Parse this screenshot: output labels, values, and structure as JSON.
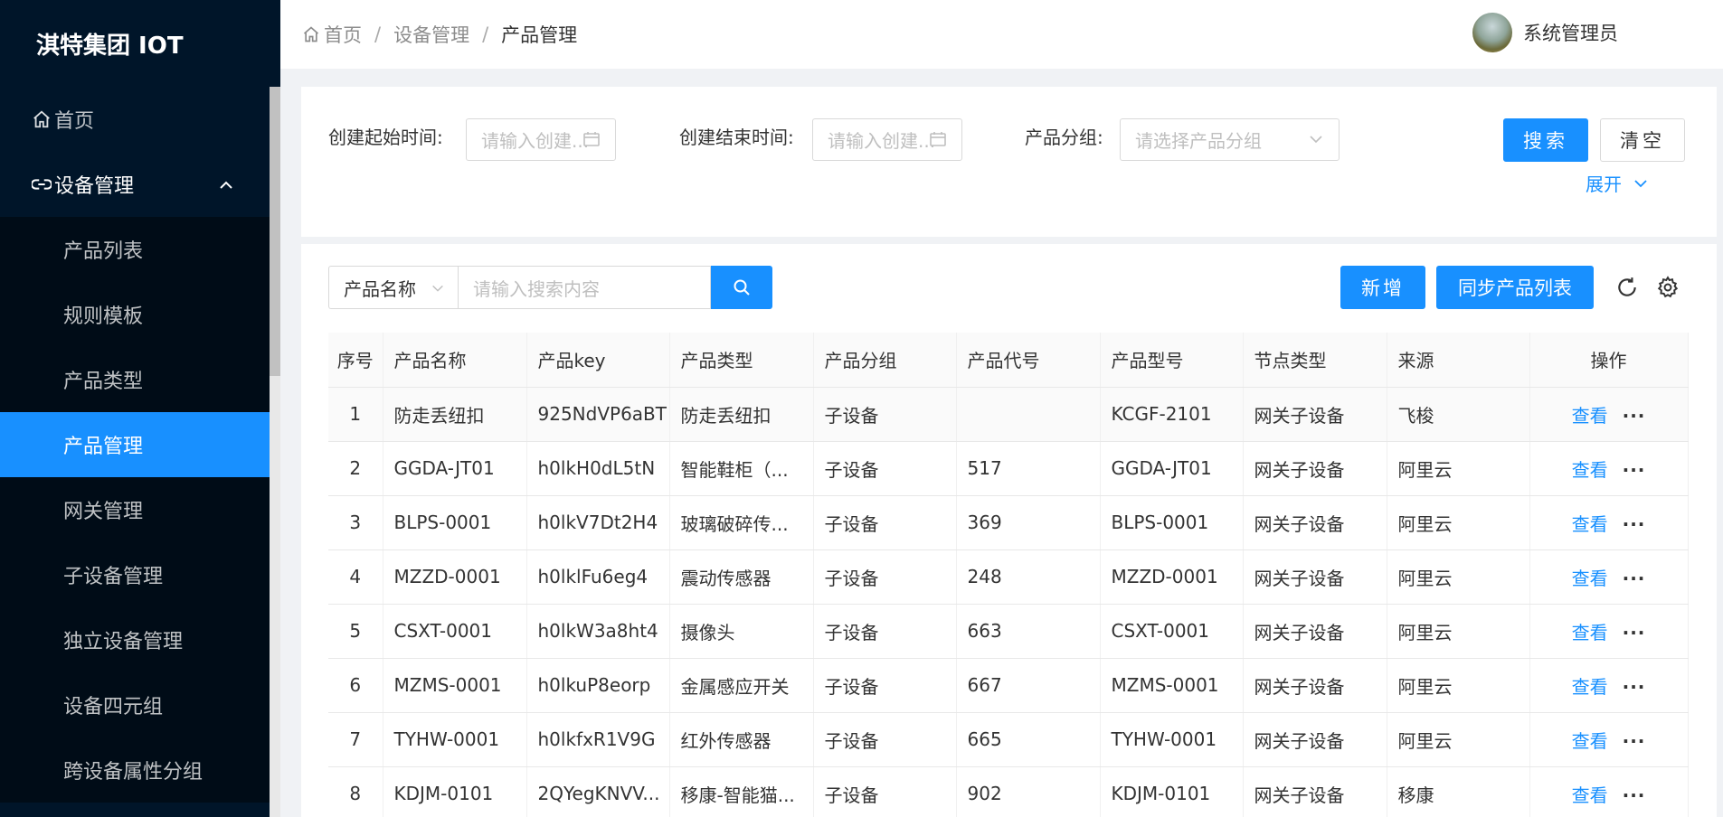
{
  "app": {
    "title": "淇特集团 IOT"
  },
  "sidebar": {
    "home": "首页",
    "group": "设备管理",
    "items": [
      {
        "label": "产品列表"
      },
      {
        "label": "规则模板"
      },
      {
        "label": "产品类型"
      },
      {
        "label": "产品管理",
        "active": true
      },
      {
        "label": "网关管理"
      },
      {
        "label": "子设备管理"
      },
      {
        "label": "独立设备管理"
      },
      {
        "label": "设备四元组"
      },
      {
        "label": "跨设备属性分组"
      }
    ]
  },
  "header": {
    "breadcrumb": [
      "首页",
      "设备管理",
      "产品管理"
    ],
    "user": "系统管理员"
  },
  "filters": {
    "start_label": "创建起始时间:",
    "start_placeholder": "请输入创建...",
    "end_label": "创建结束时间:",
    "end_placeholder": "请输入创建...",
    "group_label": "产品分组:",
    "group_placeholder": "请选择产品分组",
    "search_btn": "搜索",
    "clear_btn": "清空",
    "expand": "展开"
  },
  "toolbar": {
    "field_select": "产品名称",
    "search_placeholder": "请输入搜索内容",
    "add_btn": "新增",
    "sync_btn": "同步产品列表"
  },
  "table": {
    "columns": [
      "序号",
      "产品名称",
      "产品key",
      "产品类型",
      "产品分组",
      "产品代号",
      "产品型号",
      "节点类型",
      "来源",
      "操作"
    ],
    "view_label": "查看",
    "more_label": "···",
    "rows": [
      [
        "1",
        "防走丢纽扣",
        "925NdVP6aBT",
        "防走丢纽扣",
        "子设备",
        "",
        "KCGF-2101",
        "网关子设备",
        "飞梭"
      ],
      [
        "2",
        "GGDA-JT01",
        "h0lkH0dL5tN",
        "智能鞋柜（...",
        "子设备",
        "517",
        "GGDA-JT01",
        "网关子设备",
        "阿里云"
      ],
      [
        "3",
        "BLPS-0001",
        "h0lkV7Dt2H4",
        "玻璃破碎传...",
        "子设备",
        "369",
        "BLPS-0001",
        "网关子设备",
        "阿里云"
      ],
      [
        "4",
        "MZZD-0001",
        "h0lklFu6eg4",
        "震动传感器",
        "子设备",
        "248",
        "MZZD-0001",
        "网关子设备",
        "阿里云"
      ],
      [
        "5",
        "CSXT-0001",
        "h0lkW3a8ht4",
        "摄像头",
        "子设备",
        "663",
        "CSXT-0001",
        "网关子设备",
        "阿里云"
      ],
      [
        "6",
        "MZMS-0001",
        "h0lkuP8eorp",
        "金属感应开关",
        "子设备",
        "667",
        "MZMS-0001",
        "网关子设备",
        "阿里云"
      ],
      [
        "7",
        "TYHW-0001",
        "h0lkfxR1V9G",
        "红外传感器",
        "子设备",
        "665",
        "TYHW-0001",
        "网关子设备",
        "阿里云"
      ],
      [
        "8",
        "KDJM-0101",
        "2QYegKNVV...",
        "移康-智能猫...",
        "子设备",
        "902",
        "KDJM-0101",
        "网关子设备",
        "移康"
      ]
    ]
  },
  "colors": {
    "primary": "#1890ff",
    "sidebar_bg": "#001529",
    "submenu_bg": "#000c17"
  }
}
